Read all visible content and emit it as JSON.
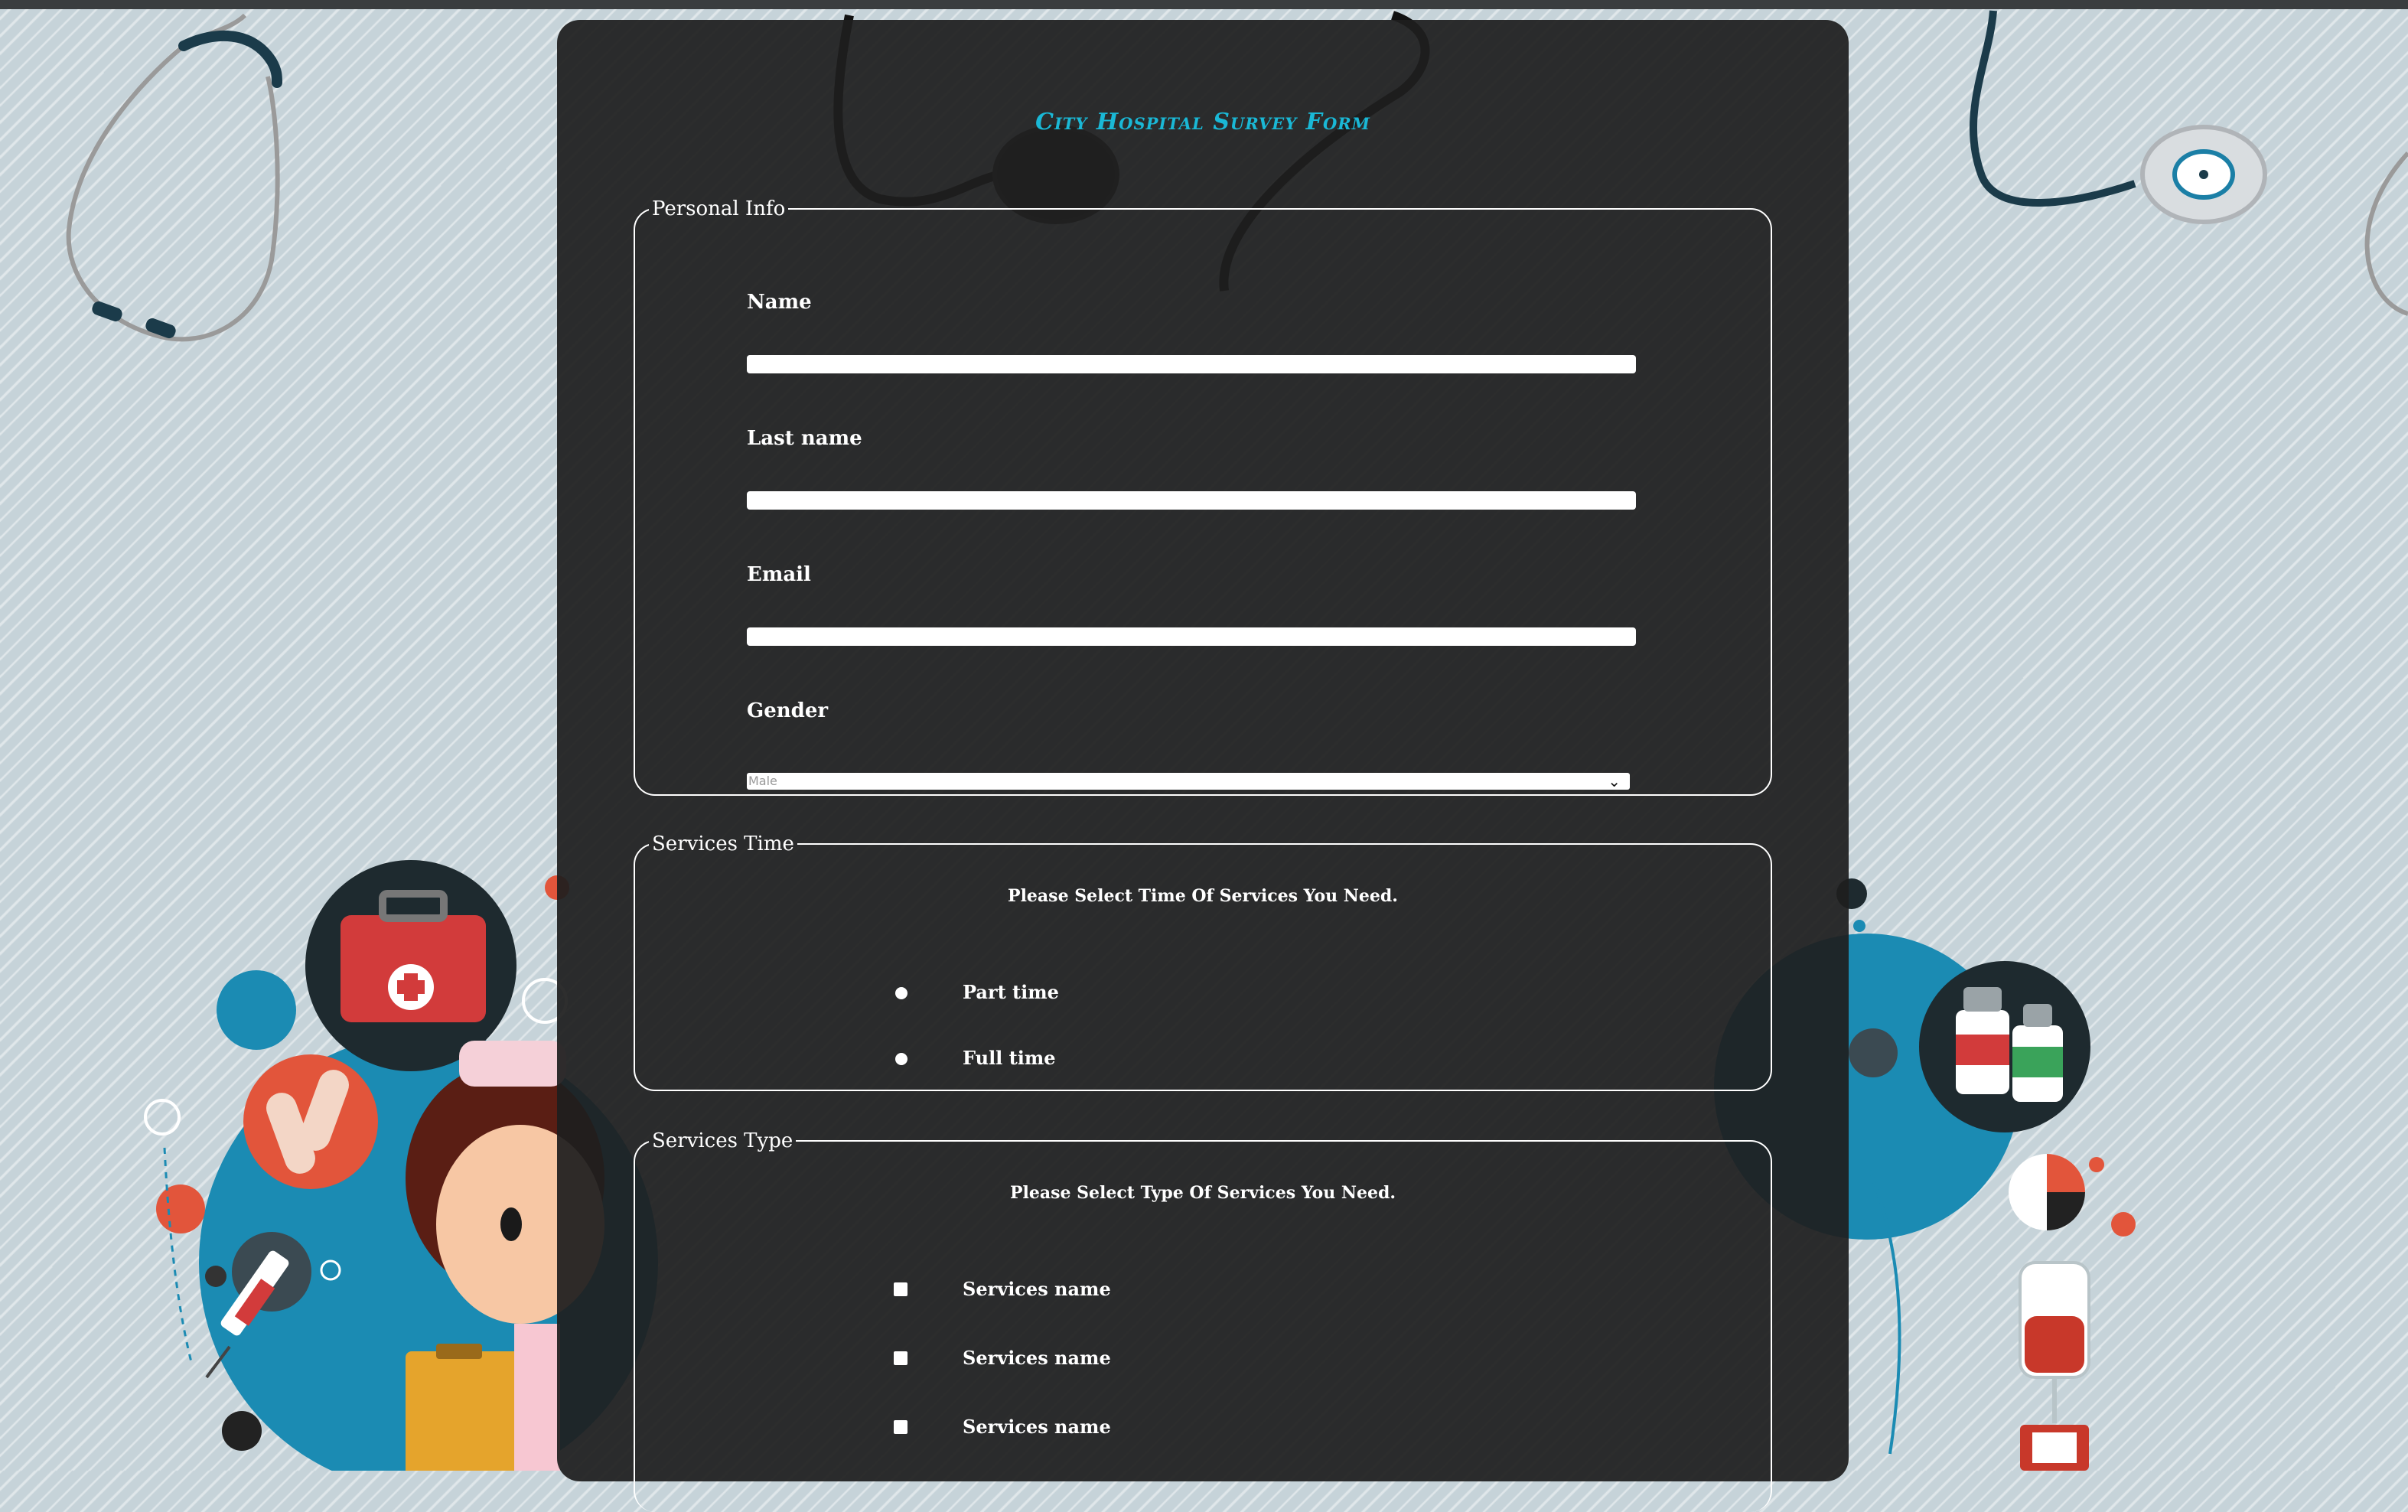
{
  "form": {
    "title": "City Hospital Survey Form"
  },
  "personal_info": {
    "legend": "Personal Info",
    "name_label": "Name",
    "last_name_label": "Last name",
    "email_label": "Email",
    "gender_label": "Gender",
    "gender_selected": "Male"
  },
  "services_time": {
    "legend": "Services Time",
    "instruction": "Please Select Time Of Services You Need.",
    "options": [
      {
        "label": "Part time"
      },
      {
        "label": "Full time"
      }
    ]
  },
  "services_type": {
    "legend": "Services Type",
    "instruction": "Please Select Type Of Services You Need.",
    "options": [
      {
        "label": "Services name"
      },
      {
        "label": "Services name"
      },
      {
        "label": "Services name"
      }
    ]
  },
  "colors": {
    "title_accent": "#1ab8d6",
    "panel_background": "#1e1e1e",
    "page_background": "#c6d3d9"
  },
  "icons": {
    "background_decor": [
      "stethoscope-icon",
      "first-aid-kit-icon",
      "bandage-icon",
      "syringe-icon",
      "medicine-bottles-icon",
      "blood-bag-icon",
      "nurse-illustration"
    ],
    "select_arrow": "chevron-down-icon"
  }
}
